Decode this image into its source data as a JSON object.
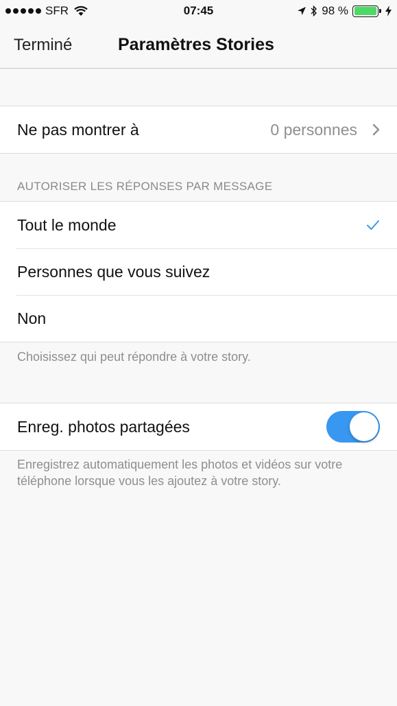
{
  "status_bar": {
    "carrier": "SFR",
    "time": "07:45",
    "battery_percent": "98 %",
    "icons": [
      "signal-dots-icon",
      "wifi-icon",
      "location-arrow-icon",
      "bluetooth-icon",
      "battery-icon",
      "charging-bolt-icon"
    ],
    "battery_level": 0.98
  },
  "nav": {
    "done_label": "Terminé",
    "title": "Paramètres Stories"
  },
  "hide_from": {
    "label": "Ne pas montrer à",
    "value": "0 personnes"
  },
  "replies": {
    "header": "AUTORISER LES RÉPONSES PAR MESSAGE",
    "options": [
      {
        "label": "Tout le monde",
        "selected": true
      },
      {
        "label": "Personnes que vous suivez",
        "selected": false
      },
      {
        "label": "Non",
        "selected": false
      }
    ],
    "footer": "Choisissez qui peut répondre à votre story."
  },
  "save_photos": {
    "label": "Enreg. photos partagées",
    "enabled": true,
    "footer": "Enregistrez automatiquement les photos et vidéos sur votre téléphone lorsque vous les ajoutez à votre story."
  },
  "colors": {
    "accent": "#3897f0",
    "battery": "#4cd964",
    "background": "#f8f8f8"
  }
}
